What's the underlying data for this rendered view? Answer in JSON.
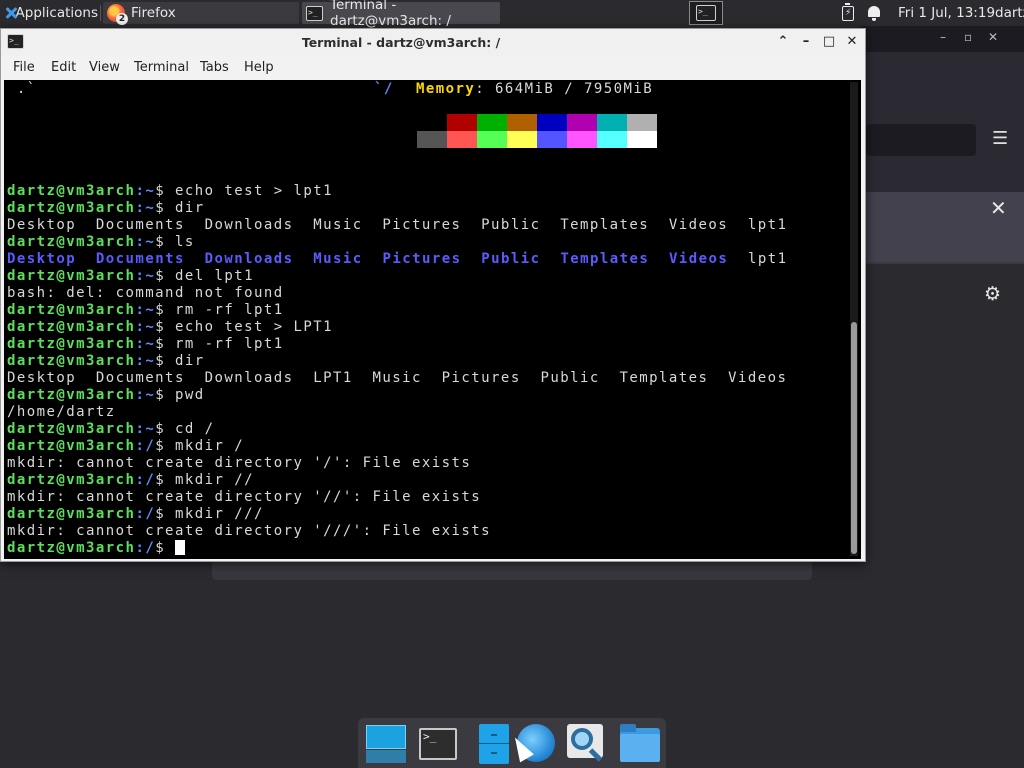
{
  "panel": {
    "apps_label": "Applications",
    "tasks": [
      {
        "label": "Firefox",
        "badge": "2",
        "icon": "firefox-icon"
      },
      {
        "label": "Terminal - dartz@vm3arch: /",
        "icon": "terminal-icon"
      }
    ],
    "battery_glyph": "⚡",
    "clock": "Fri  1 Jul, 13:19",
    "user": "dartz"
  },
  "firefox": {
    "ctrl_min": "–",
    "ctrl_max": "▫",
    "ctrl_close": "✕",
    "menu_glyph": "☰",
    "close_glyph": "✕",
    "settings_glyph": "⚙"
  },
  "terminal": {
    "title": "Terminal - dartz@vm3arch: /",
    "controls": {
      "shade": "⌃",
      "minimize": "–",
      "maximize": "□",
      "close": "✕"
    },
    "menu": [
      "File",
      "Edit",
      "View",
      "Terminal",
      "Tabs",
      "Help"
    ],
    "neofetch": {
      "art_left": " .`",
      "art_right": "`/",
      "mem_key": "Memory",
      "mem_value": ": 664MiB / 7950MiB",
      "palette_top": [
        "#000000",
        "#b00000",
        "#00b000",
        "#b06000",
        "#0000c0",
        "#b000b0",
        "#00b0b0",
        "#b0b0b0"
      ],
      "palette_bottom": [
        "#555555",
        "#ff5555",
        "#55ff55",
        "#ffff55",
        "#5555ff",
        "#ff55ff",
        "#55ffff",
        "#ffffff"
      ]
    },
    "prompt_user": "dartz@vm3arch",
    "lines": [
      {
        "path": ":~",
        "cmd": "$ echo test > lpt1"
      },
      {
        "path": ":~",
        "cmd": "$ dir"
      },
      {
        "out": "Desktop  Documents  Downloads  Music  Pictures  Public  Templates  Videos  lpt1"
      },
      {
        "path": ":~",
        "cmd": "$ ls"
      },
      {
        "ls_dirs": [
          "Desktop",
          "Documents",
          "Downloads",
          "Music",
          "Pictures",
          "Public",
          "Templates",
          "Videos"
        ],
        "ls_file": "lpt1"
      },
      {
        "path": ":~",
        "cmd": "$ del lpt1"
      },
      {
        "out": "bash: del: command not found"
      },
      {
        "path": ":~",
        "cmd": "$ rm -rf lpt1"
      },
      {
        "path": ":~",
        "cmd": "$ echo test > LPT1"
      },
      {
        "path": ":~",
        "cmd": "$ rm -rf lpt1"
      },
      {
        "path": ":~",
        "cmd": "$ dir"
      },
      {
        "out": "Desktop  Documents  Downloads  LPT1  Music  Pictures  Public  Templates  Videos"
      },
      {
        "path": ":~",
        "cmd": "$ pwd"
      },
      {
        "out": "/home/dartz"
      },
      {
        "path": ":~",
        "cmd": "$ cd /"
      },
      {
        "path": ":/",
        "cmd": "$ mkdir /"
      },
      {
        "out": "mkdir: cannot create directory '/': File exists"
      },
      {
        "path": ":/",
        "cmd": "$ mkdir //"
      },
      {
        "out": "mkdir: cannot create directory '//': File exists"
      },
      {
        "path": ":/",
        "cmd": "$ mkdir ///"
      },
      {
        "out": "mkdir: cannot create directory '///': File exists"
      },
      {
        "path": ":/",
        "cmd": "$ ",
        "cursor": true
      }
    ]
  },
  "dock": {
    "items": [
      {
        "name": "show-desktop",
        "icon": "desktop-icon"
      },
      {
        "name": "terminal",
        "icon": "terminal-icon",
        "glyph": ">_"
      },
      {
        "name": "file-manager",
        "icon": "file-cabinet-icon"
      },
      {
        "name": "web-browser",
        "icon": "globe-icon"
      },
      {
        "name": "app-finder",
        "icon": "magnifier-icon"
      },
      {
        "name": "home-folder",
        "icon": "folder-icon"
      }
    ]
  },
  "colors": {
    "prompt_user": "#5be05b",
    "prompt_path": "#5b8cff",
    "directory": "#5b5bff",
    "memory_key": "#ffd700",
    "panel_bg": "#2b2a2e"
  }
}
